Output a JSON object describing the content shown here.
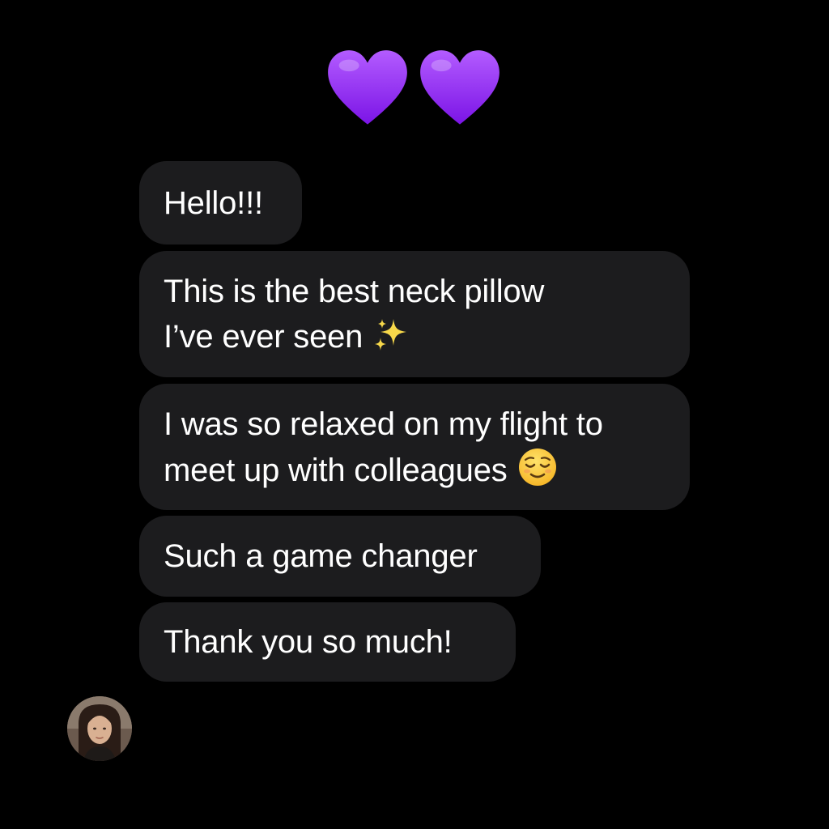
{
  "reaction": {
    "icons": [
      "purple-heart-icon",
      "purple-heart-icon"
    ],
    "color": "#9b30ff"
  },
  "messages": [
    {
      "lines": [
        "Hello!!!"
      ]
    },
    {
      "lines": [
        "This is the best neck pillow",
        "I’ve ever seen"
      ],
      "emoji": "sparkles-icon"
    },
    {
      "lines": [
        "I was so relaxed on my flight to",
        "meet up with colleagues"
      ],
      "emoji": "relieved-face-icon"
    },
    {
      "lines": [
        "Such a game changer"
      ]
    },
    {
      "lines": [
        "Thank you so much!"
      ]
    }
  ],
  "theme": {
    "background": "#000000",
    "bubble": "#1c1c1e",
    "text": "#ffffff"
  },
  "sender": {
    "avatar_icon": "avatar"
  }
}
